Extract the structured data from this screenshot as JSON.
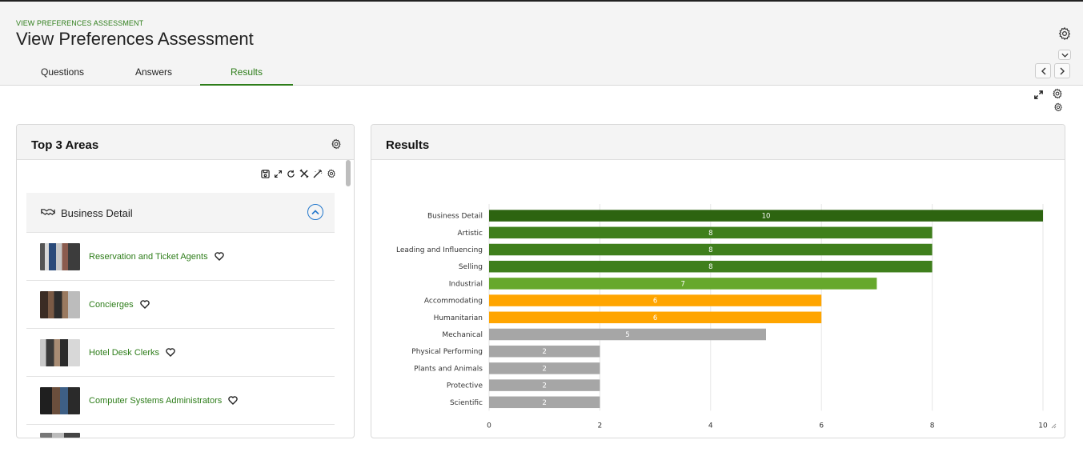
{
  "header": {
    "breadcrumb": "VIEW PREFERENCES ASSESSMENT",
    "title": "View Preferences Assessment"
  },
  "tabs": [
    {
      "label": "Questions",
      "active": false
    },
    {
      "label": "Answers",
      "active": false
    },
    {
      "label": "Results",
      "active": true
    }
  ],
  "header_icons": [
    "gear-icon",
    "chevron-down-icon",
    "chevron-left-icon",
    "chevron-right-icon",
    "expand-icon",
    "gear-icon"
  ],
  "left_panel": {
    "title": "Top 3 Areas",
    "toolbar_icons": [
      "save-icon",
      "expand-icon",
      "refresh-icon",
      "tools-icon",
      "magic-wand-icon",
      "gear-icon"
    ],
    "group": {
      "label": "Business Detail",
      "icon": "handshake-icon"
    },
    "jobs": [
      {
        "title": "Reservation and Ticket Agents"
      },
      {
        "title": "Concierges"
      },
      {
        "title": "Hotel Desk Clerks"
      },
      {
        "title": "Computer Systems Administrators"
      }
    ]
  },
  "right_panel": {
    "title": "Results"
  },
  "colors": {
    "brand_green": "#2e7d1a",
    "top": "#2d6410",
    "high": "#3f7f1c",
    "mid_green": "#66a82c",
    "orange": "#ffa500",
    "gray": "#a6a6a6"
  },
  "chart_data": {
    "type": "bar",
    "orientation": "horizontal",
    "categories": [
      "Business Detail",
      "Artistic",
      "Leading and Influencing",
      "Selling",
      "Industrial",
      "Accommodating",
      "Humanitarian",
      "Mechanical",
      "Physical Performing",
      "Plants and Animals",
      "Protective",
      "Scientific"
    ],
    "values": [
      10,
      8,
      8,
      8,
      7,
      6,
      6,
      5,
      2,
      2,
      2,
      2
    ],
    "bar_colors": [
      "#2d6410",
      "#3f7f1c",
      "#3f7f1c",
      "#3f7f1c",
      "#66a82c",
      "#ffa500",
      "#ffa500",
      "#a6a6a6",
      "#a6a6a6",
      "#a6a6a6",
      "#a6a6a6",
      "#a6a6a6"
    ],
    "xlim": [
      0,
      10
    ],
    "xticks": [
      0,
      2,
      4,
      6,
      8,
      10
    ],
    "grid": true,
    "data_labels": true
  }
}
